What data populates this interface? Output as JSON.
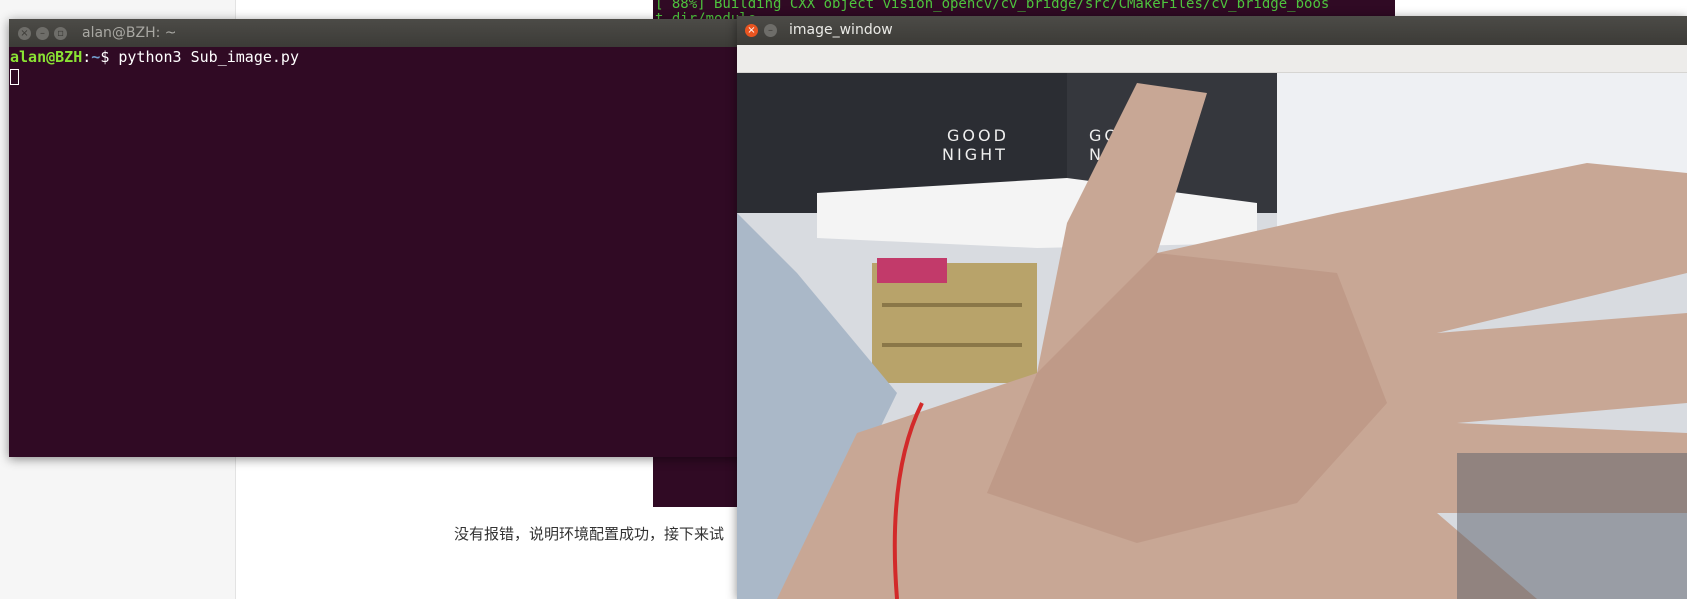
{
  "article": {
    "text": "没有报错，说明环境配置成功，接下来试"
  },
  "background_terminal": {
    "lines": [
      "[ 88%] Building CXX object vision_opencv/cv_bridge/src/CMakeFiles/cv_bridge_boos",
      "t.dir/module"
    ]
  },
  "terminal": {
    "title": "alan@BZH: ~",
    "prompt_user": "alan@BZH",
    "prompt_sep": ":",
    "prompt_path": "~",
    "prompt_symbol": "$ ",
    "command": "python3 Sub_image.py"
  },
  "image_window": {
    "title": "image_window",
    "poster_text_1": "GOOD",
    "poster_text_2": "NIGHT"
  }
}
